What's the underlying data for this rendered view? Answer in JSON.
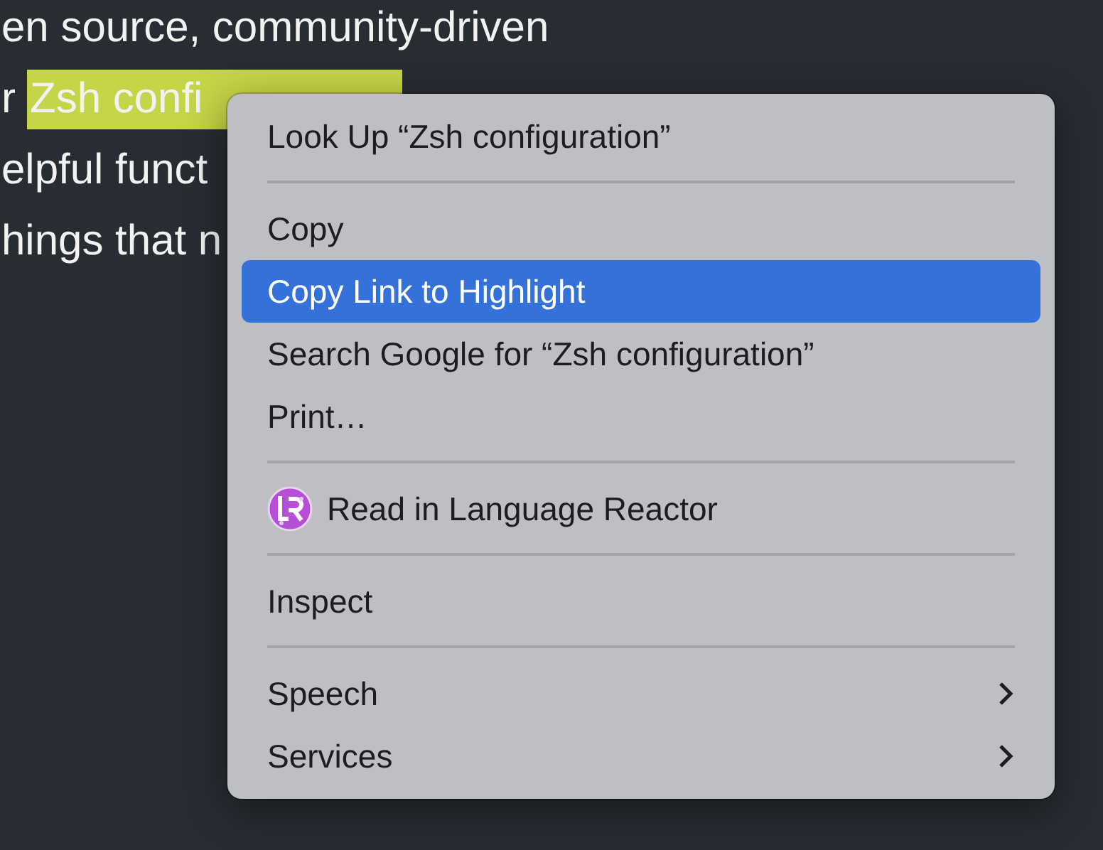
{
  "page_text": {
    "lines": [
      {
        "segments": [
          {
            "text": "en source, community-driven",
            "highlighted": false
          }
        ]
      },
      {
        "segments": [
          {
            "text": "r",
            "highlighted": false
          },
          {
            "text": "Zsh confi",
            "highlighted": true
          }
        ]
      },
      {
        "segments": [
          {
            "text": "elpful funct",
            "highlighted": false
          }
        ]
      },
      {
        "segments": [
          {
            "text": "hings that n",
            "highlighted": false
          }
        ]
      }
    ]
  },
  "context_menu": {
    "items": [
      {
        "kind": "item",
        "label": "Look Up “Zsh configuration”",
        "selected": false
      },
      {
        "kind": "separator"
      },
      {
        "kind": "item",
        "label": "Copy",
        "selected": false
      },
      {
        "kind": "item",
        "label": "Copy Link to Highlight",
        "selected": true
      },
      {
        "kind": "item",
        "label": "Search Google for “Zsh configuration”",
        "selected": false
      },
      {
        "kind": "item",
        "label": "Print…",
        "selected": false
      },
      {
        "kind": "separator"
      },
      {
        "kind": "extension",
        "label": "Read in Language Reactor",
        "selected": false
      },
      {
        "kind": "separator"
      },
      {
        "kind": "item",
        "label": "Inspect",
        "selected": false
      },
      {
        "kind": "separator"
      },
      {
        "kind": "submenu",
        "label": "Speech",
        "selected": false
      },
      {
        "kind": "submenu",
        "label": "Services",
        "selected": false
      }
    ]
  }
}
